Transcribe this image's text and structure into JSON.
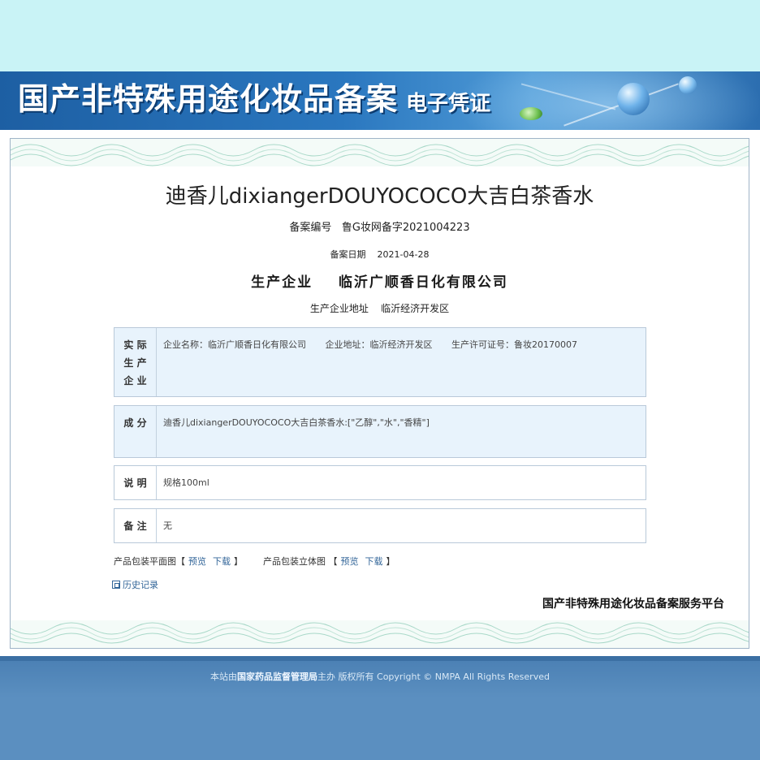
{
  "banner": {
    "title": "国产非特殊用途化妆品备案",
    "subtitle": "电子凭证"
  },
  "certificate": {
    "product_name": "迪香儿dixiangerDOUYOCOCO大吉白茶香水",
    "record_number_label": "备案编号",
    "record_number": "鲁G妆网备字2021004223",
    "record_date_label": "备案日期",
    "record_date": "2021-04-28",
    "manufacturer_label": "生产企业",
    "manufacturer": "临沂广顺香日化有限公司",
    "address_label": "生产企业地址",
    "address": "临沂经济开发区"
  },
  "sections": {
    "actual_mfr": {
      "label_line1": "实 际",
      "label_line2": "生 产",
      "label_line3": "企 业",
      "company_name": "企业名称：临沂广顺香日化有限公司",
      "company_address": "企业地址：临沂经济开发区",
      "license": "生产许可证号：鲁妆20170007"
    },
    "ingredients": {
      "label": "成 分",
      "text": "迪香儿dixiangerDOUYOCOCO大吉白茶香水:[\"乙醇\",\"水\",\"香精\"]"
    },
    "description": {
      "label": "说 明",
      "text": "规格100ml"
    },
    "remarks": {
      "label": "备 注",
      "text": "无"
    }
  },
  "links": {
    "flat_label": "产品包装平面图【",
    "flat_preview": "预览",
    "flat_download": "下载",
    "flat_close": "】",
    "stereo_label": "产品包装立体图 【",
    "stereo_preview": "预览",
    "stereo_download": "下载",
    "stereo_close": "】",
    "history": "历史记录"
  },
  "platform_name": "国产非特殊用途化妆品备案服务平台",
  "footer": {
    "prefix": "本站由",
    "agency": "国家药品监督管理局",
    "suffix": "主办 版权所有 Copyright © NMPA All Rights Reserved"
  },
  "colors": {
    "banner_blue": "#2a77bf",
    "section_bg": "#e8f3fc",
    "page_bg": "#5b8fc0",
    "top_band": "#c9f3f6"
  }
}
